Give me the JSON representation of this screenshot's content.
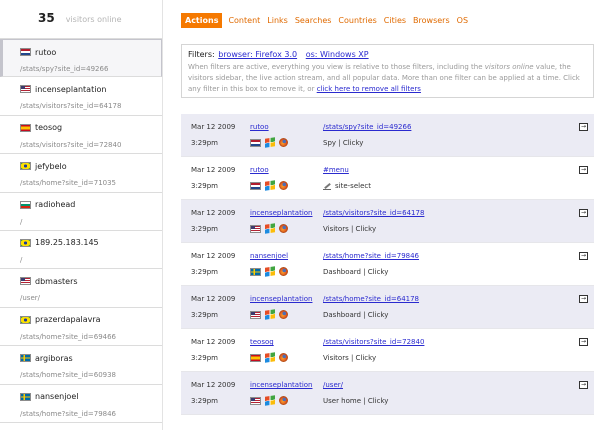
{
  "sidebar": {
    "online_count": "35",
    "online_label": "visitors online",
    "visitors": [
      {
        "flag": "nl",
        "name": "rutoo",
        "path": "/stats/spy?site_id=49266"
      },
      {
        "flag": "us",
        "name": "incenseplantation",
        "path": "/stats/visitors?site_id=64178"
      },
      {
        "flag": "es",
        "name": "teosog",
        "path": "/stats/visitors?site_id=72840"
      },
      {
        "flag": "br",
        "name": "jefybelo",
        "path": "/stats/home?site_id=71035"
      },
      {
        "flag": "bg",
        "name": "radiohead",
        "path": "/"
      },
      {
        "flag": "br",
        "name": "189.25.183.145",
        "path": "/"
      },
      {
        "flag": "us",
        "name": "dbmasters",
        "path": "/user/"
      },
      {
        "flag": "br",
        "name": "prazerdapalavra",
        "path": "/stats/home?site_id=69466"
      },
      {
        "flag": "se",
        "name": "argiboras",
        "path": "/stats/home?site_id=60938"
      },
      {
        "flag": "se",
        "name": "nansenjoel",
        "path": "/stats/home?site_id=79846"
      }
    ]
  },
  "tabs": {
    "actions": "Actions",
    "content": "Content",
    "links": "Links",
    "searches": "Searches",
    "countries": "Countries",
    "cities": "Cities",
    "browsers": "Browsers",
    "os": "OS"
  },
  "filters": {
    "label": "Filters:",
    "browser_filter": "browser: Firefox 3.0",
    "os_filter": "os: Windows XP",
    "desc_part1": "When filters are active, everything you view is relative to those filters, including the",
    "desc_em": "visitors online",
    "desc_part2": "value, the visitors sidebar, the live action stream, and all popular data. More than one filter can be applied at a time. Click any filter in this box to remove it, or",
    "remove_all": "click here to remove all filters"
  },
  "actions": [
    {
      "date": "Mar 12 2009",
      "time": "3:29pm",
      "user": "rutoo",
      "flag": "nl",
      "url": "/stats/spy?site_id=49266",
      "title": "Spy | Clicky",
      "icon": ""
    },
    {
      "date": "Mar 12 2009",
      "time": "3:29pm",
      "user": "rutoo",
      "flag": "nl",
      "url": "#menu",
      "title": "site-select",
      "icon": "pen"
    },
    {
      "date": "Mar 12 2009",
      "time": "3:29pm",
      "user": "incenseplantation",
      "flag": "us",
      "url": "/stats/visitors?site_id=64178",
      "title": "Visitors | Clicky",
      "icon": ""
    },
    {
      "date": "Mar 12 2009",
      "time": "3:29pm",
      "user": "nansenjoel",
      "flag": "se",
      "url": "/stats/home?site_id=79846",
      "title": "Dashboard | Clicky",
      "icon": ""
    },
    {
      "date": "Mar 12 2009",
      "time": "3:29pm",
      "user": "incenseplantation",
      "flag": "us",
      "url": "/stats/home?site_id=64178",
      "title": "Dashboard | Clicky",
      "icon": ""
    },
    {
      "date": "Mar 12 2009",
      "time": "3:29pm",
      "user": "teosog",
      "flag": "es",
      "url": "/stats/visitors?site_id=72840",
      "title": "Visitors | Clicky",
      "icon": ""
    },
    {
      "date": "Mar 12 2009",
      "time": "3:29pm",
      "user": "incenseplantation",
      "flag": "us",
      "url": "/user/",
      "title": "User home | Clicky",
      "icon": ""
    }
  ],
  "colors": {
    "accent": "#f57900",
    "row_shade": "#ebebf4",
    "link": "#2a2acf"
  },
  "icons": {
    "os": "windows-xp-icon",
    "browser": "firefox-icon",
    "expand": "expand-arrow-icon"
  }
}
